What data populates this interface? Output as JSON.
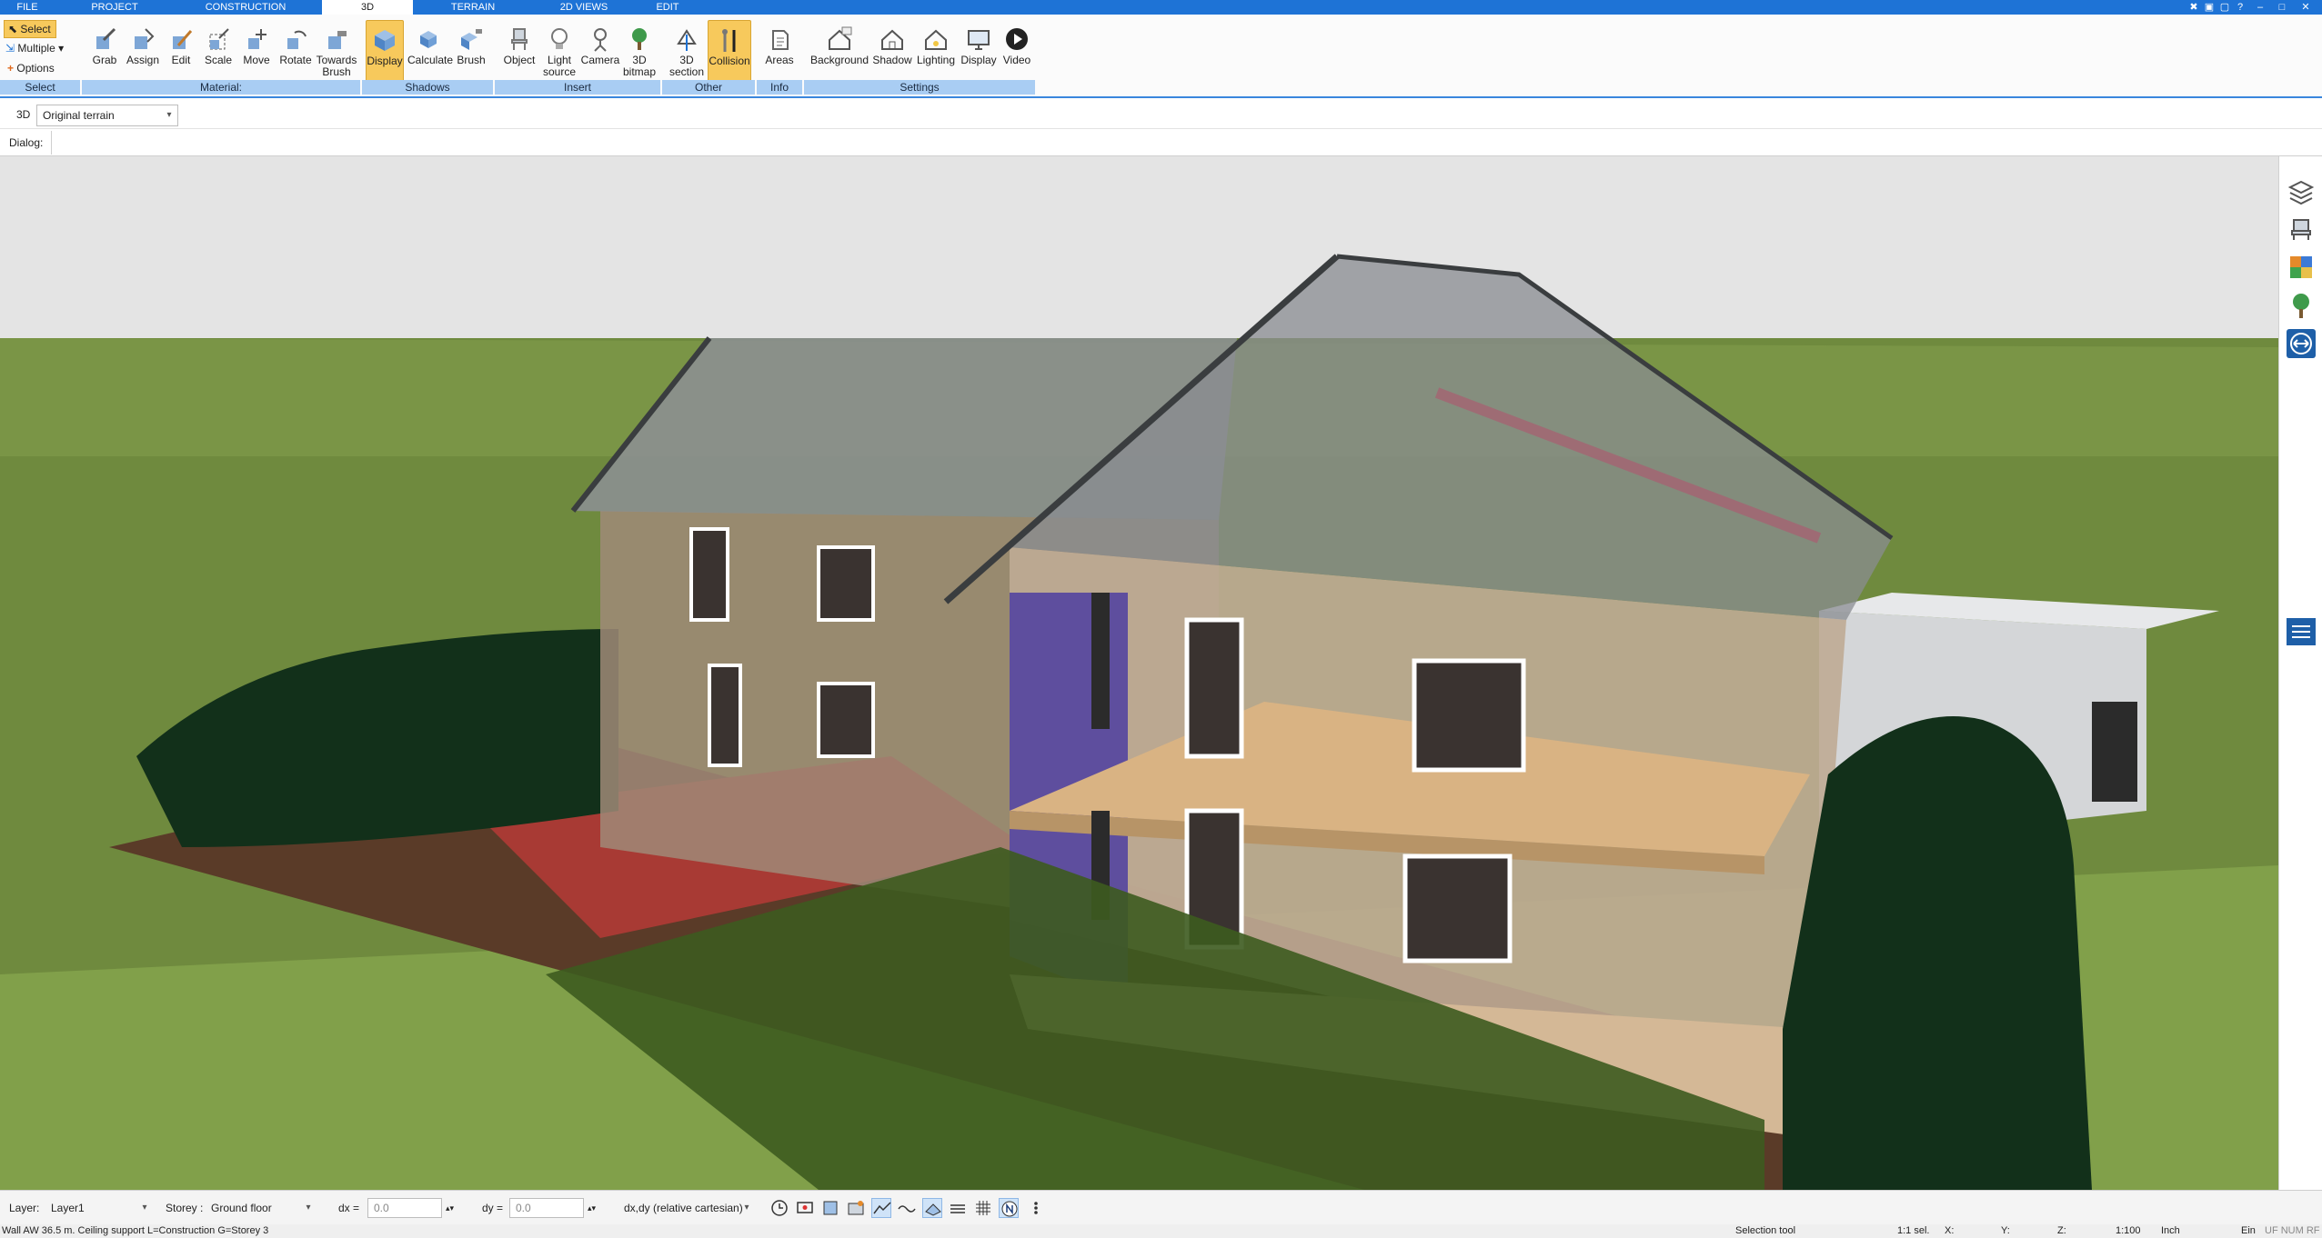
{
  "menu": {
    "tabs": [
      "FILE",
      "PROJECT",
      "CONSTRUCTION",
      "3D",
      "TERRAIN",
      "2D VIEWS",
      "EDIT"
    ],
    "active": "3D"
  },
  "ribbon": {
    "select_group": {
      "select": "Select",
      "multiple": "Multiple",
      "options": "Options",
      "label": "Select"
    },
    "material": {
      "grab": "Grab",
      "assign": "Assign",
      "edit": "Edit",
      "scale": "Scale",
      "move": "Move",
      "rotate": "Rotate",
      "towards1": "Towards",
      "towards2": "Brush",
      "label": "Material:"
    },
    "shadows": {
      "display": "Display",
      "calculate": "Calculate",
      "brush": "Brush",
      "label": "Shadows"
    },
    "insert": {
      "object": "Object",
      "light1": "Light",
      "light2": "source",
      "camera": "Camera",
      "bitmap1": "3D",
      "bitmap2": "bitmap",
      "label": "Insert"
    },
    "other": {
      "section1": "3D",
      "section2": "section",
      "collision": "Collision",
      "label": "Other"
    },
    "info": {
      "areas": "Areas",
      "label": "Info"
    },
    "settings": {
      "background": "Background",
      "shadow": "Shadow",
      "lighting": "Lighting",
      "display": "Display",
      "video": "Video",
      "label": "Settings"
    }
  },
  "bar3d": {
    "mode": "3D",
    "terrain": "Original terrain"
  },
  "dialog": {
    "label": "Dialog:"
  },
  "status": {
    "layer_label": "Layer:",
    "layer_value": "Layer1",
    "storey_label": "Storey :",
    "storey_value": "Ground floor",
    "dx_label": "dx =",
    "dx_value": "0.0",
    "dy_label": "dy =",
    "dy_value": "0.0",
    "coord_mode": "dx,dy (relative cartesian)"
  },
  "info": {
    "element": "Wall AW 36.5 m. Ceiling support L=Construction G=Storey 3",
    "tool": "Selection tool",
    "selection": "1:1 sel.",
    "x": "X:",
    "y": "Y:",
    "z": "Z:",
    "scale": "1:100",
    "unit": "Inch",
    "ein": "Ein",
    "flags": "UF NUM RF"
  },
  "colors": {
    "accent": "#1e73d6",
    "group_bar": "#a9cdf3",
    "active_button": "#f7c95c",
    "grass": "#6f8a3e",
    "sky": "#e4e4e4"
  }
}
